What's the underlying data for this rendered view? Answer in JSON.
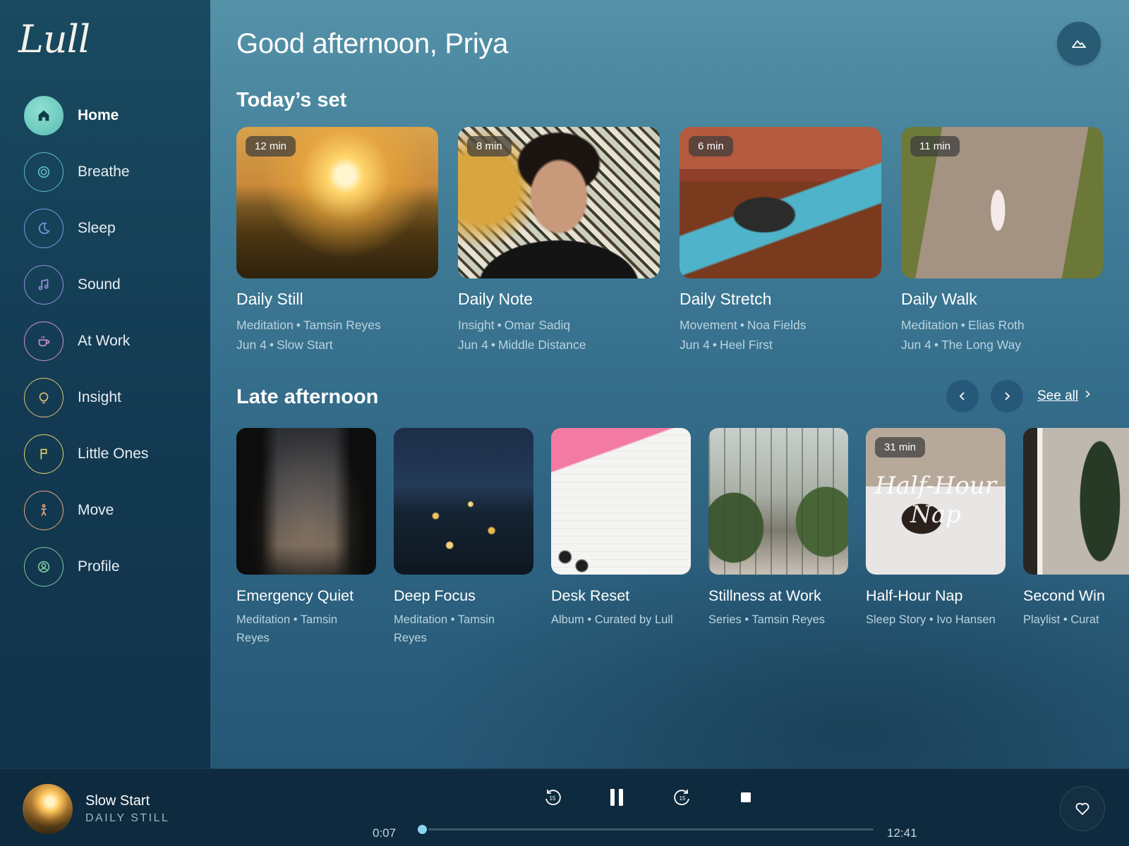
{
  "app": {
    "logo": "Lull"
  },
  "sidebar": {
    "items": [
      {
        "label": "Home",
        "icon": "home-icon",
        "color": "#6cc9bc",
        "active": true
      },
      {
        "label": "Breathe",
        "icon": "breathe-icon",
        "color": "#5fb9c9"
      },
      {
        "label": "Sleep",
        "icon": "moon-icon",
        "color": "#6f9fe0"
      },
      {
        "label": "Sound",
        "icon": "music-note-icon",
        "color": "#9a8ee0"
      },
      {
        "label": "At Work",
        "icon": "coffee-cup-icon",
        "color": "#d48fd0"
      },
      {
        "label": "Insight",
        "icon": "lightbulb-icon",
        "color": "#e0c070"
      },
      {
        "label": "Little Ones",
        "icon": "flag-icon",
        "color": "#e3d36a"
      },
      {
        "label": "Move",
        "icon": "figure-icon",
        "color": "#e8a878"
      },
      {
        "label": "Profile",
        "icon": "user-circle-icon",
        "color": "#7cc9a0"
      }
    ]
  },
  "header": {
    "greeting": "Good afternoon, Priya",
    "right_button_icon": "mountain-icon"
  },
  "today": {
    "title": "Today’s set",
    "cards": [
      {
        "duration": "12 min",
        "title": "Daily Still",
        "category": "Meditation",
        "author": "Tamsin Reyes",
        "date": "Jun 4",
        "episode": "Slow Start"
      },
      {
        "duration": "8 min",
        "title": "Daily Note",
        "category": "Insight",
        "author": "Omar Sadiq",
        "date": "Jun 4",
        "episode": "Middle Distance"
      },
      {
        "duration": "6 min",
        "title": "Daily Stretch",
        "category": "Movement",
        "author": "Noa Fields",
        "date": "Jun 4",
        "episode": "Heel First"
      },
      {
        "duration": "11 min",
        "title": "Daily Walk",
        "category": "Meditation",
        "author": "Elias Roth",
        "date": "Jun 4",
        "episode": "The Long Way"
      }
    ]
  },
  "late": {
    "title": "Late afternoon",
    "see_all": "See all",
    "cards": [
      {
        "title": "Emergency Quiet",
        "meta_line1": "Meditation • Tamsin",
        "meta_line2": "Reyes"
      },
      {
        "title": "Deep Focus",
        "meta_line1": "Meditation • Tamsin",
        "meta_line2": "Reyes"
      },
      {
        "title": "Desk Reset",
        "meta_line1": "Album • Curated by Lull",
        "meta_line2": ""
      },
      {
        "title": "Stillness at Work",
        "meta_line1": "Series • Tamsin Reyes",
        "meta_line2": ""
      },
      {
        "title": "Half-Hour Nap",
        "meta_line1": "Sleep Story • Ivo Hansen",
        "meta_line2": "",
        "duration": "31 min",
        "art_text": "Half-Hour Nap"
      },
      {
        "title": "Second Win",
        "meta_line1": "Playlist • Curat",
        "meta_line2": ""
      }
    ]
  },
  "player": {
    "title": "Slow Start",
    "subtitle": "DAILY STILL",
    "elapsed": "0:07",
    "total": "12:41",
    "progress": 0.009
  }
}
